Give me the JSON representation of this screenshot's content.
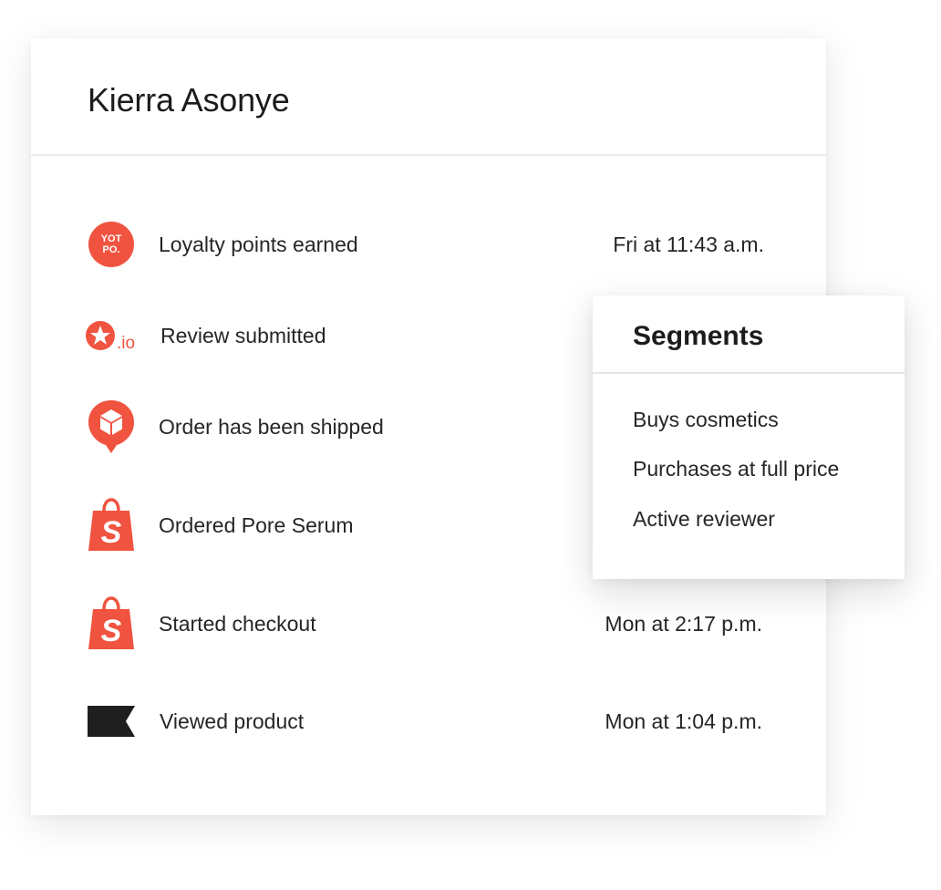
{
  "profile": {
    "name": "Kierra Asonye"
  },
  "colors": {
    "accent": "#f0533f",
    "dark": "#1f1f1f"
  },
  "events": [
    {
      "label": "Loyalty points earned",
      "time": "Fri at 11:43 a.m.",
      "icon": "yotpo-logo-icon",
      "icon_text": "YOT PO."
    },
    {
      "label": "Review submitted",
      "time": "",
      "icon": "reviews-io-logo-icon",
      "icon_text": ".io"
    },
    {
      "label": "Order has been shipped",
      "time": "",
      "icon": "shipping-box-pin-icon"
    },
    {
      "label": "Ordered Pore Serum",
      "time": "",
      "icon": "shopify-bag-icon"
    },
    {
      "label": "Started checkout",
      "time": "Mon at 2:17 p.m.",
      "icon": "shopify-bag-icon"
    },
    {
      "label": "Viewed product",
      "time": "Mon at 1:04 p.m.",
      "icon": "flag-icon"
    }
  ],
  "segments": {
    "title": "Segments",
    "items": [
      "Buys cosmetics",
      "Purchases at full price",
      "Active reviewer"
    ]
  }
}
